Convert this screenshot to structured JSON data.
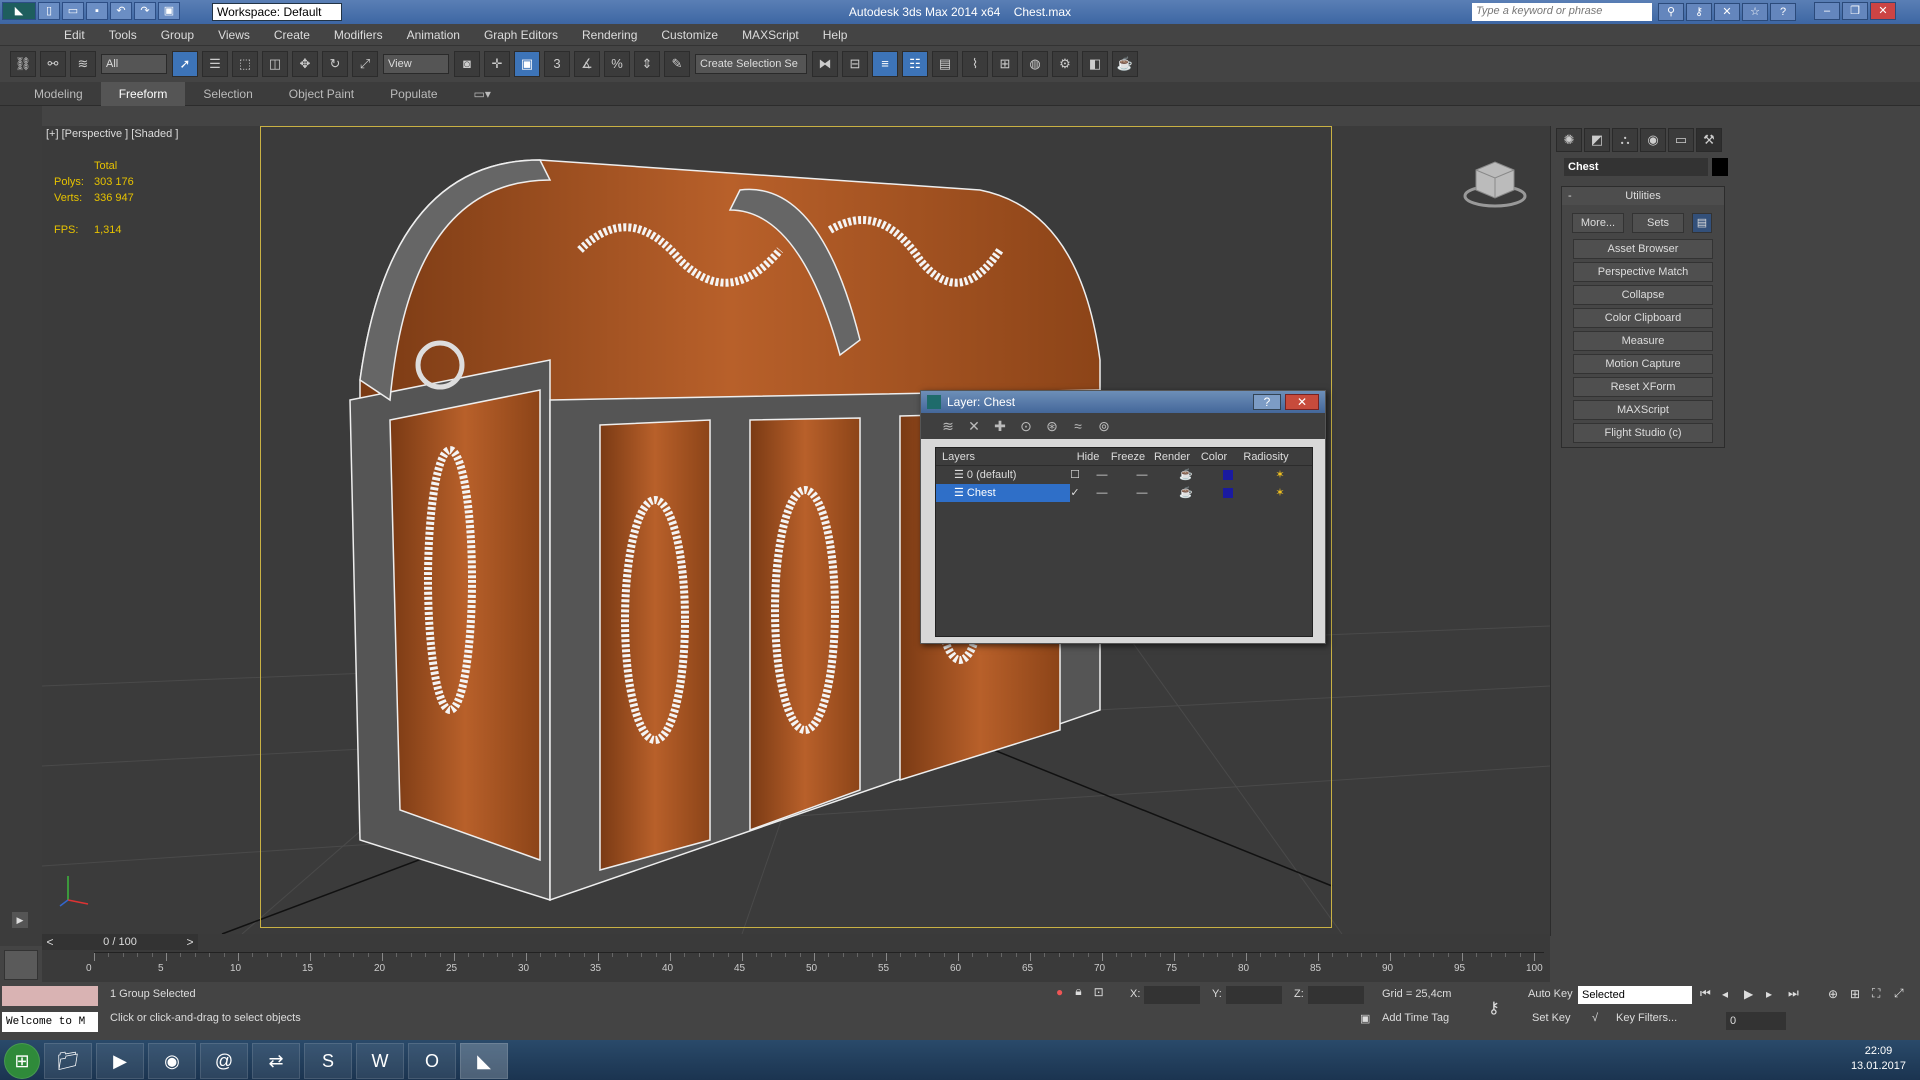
{
  "app": {
    "title": "Autodesk 3ds Max 2014 x64",
    "file": "Chest.max",
    "workspace": "Workspace: Default",
    "search_placeholder": "Type a keyword or phrase"
  },
  "menu": [
    "Edit",
    "Tools",
    "Group",
    "Views",
    "Create",
    "Modifiers",
    "Animation",
    "Graph Editors",
    "Rendering",
    "Customize",
    "MAXScript",
    "Help"
  ],
  "toolbar": {
    "selection_filter": "All",
    "ref_coord": "View",
    "named_selection": "Create Selection Se"
  },
  "ribbon": {
    "tabs": [
      "Modeling",
      "Freeform",
      "Selection",
      "Object Paint",
      "Populate"
    ],
    "active": "Freeform"
  },
  "viewport": {
    "label": "[+] [Perspective ] [Shaded ]",
    "stats": {
      "total_label": "Total",
      "polys_label": "Polys:",
      "polys": "303 176",
      "verts_label": "Verts:",
      "verts": "336 947",
      "fps_label": "FPS:",
      "fps": "1,314"
    }
  },
  "command_panel": {
    "object_name": "Chest",
    "rollout": "Utilities",
    "more": "More...",
    "sets": "Sets",
    "utilities": [
      "Asset Browser",
      "Perspective Match",
      "Collapse",
      "Color Clipboard",
      "Measure",
      "Motion Capture",
      "Reset XForm",
      "MAXScript",
      "Flight Studio (c)"
    ]
  },
  "layer_window": {
    "title": "Layer: Chest",
    "columns": [
      "Layers",
      "Hide",
      "Freeze",
      "Render",
      "Color",
      "Radiosity"
    ],
    "layers": [
      {
        "name": "0 (default)",
        "active": false,
        "color": "#1a1aa0"
      },
      {
        "name": "Chest",
        "active": true,
        "color": "#1a1aa0"
      }
    ]
  },
  "timeline": {
    "frame": "0 / 100",
    "ticks": [
      "0",
      "5",
      "10",
      "15",
      "20",
      "25",
      "30",
      "35",
      "40",
      "45",
      "50",
      "55",
      "60",
      "65",
      "70",
      "75",
      "80",
      "85",
      "90",
      "95",
      "100"
    ]
  },
  "status": {
    "selection": "1 Group Selected",
    "prompt": "Click or click-and-drag to select objects",
    "welcome": "Welcome to M",
    "x_label": "X:",
    "y_label": "Y:",
    "z_label": "Z:",
    "grid": "Grid = 25,4cm",
    "add_time_tag": "Add Time Tag",
    "auto_key": "Auto Key",
    "set_key": "Set Key",
    "key_mode": "Selected",
    "key_filters": "Key Filters...",
    "frame_field": "0"
  },
  "taskbar": {
    "time": "22:09",
    "date": "13.01.2017"
  }
}
